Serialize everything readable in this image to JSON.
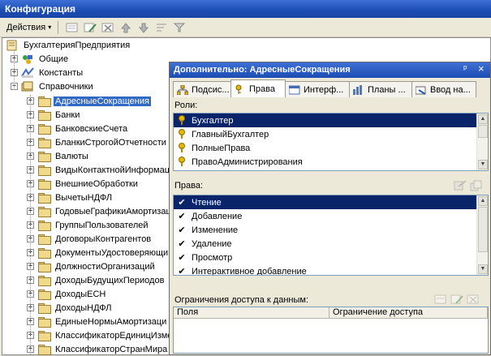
{
  "window": {
    "title": "Конфигурация"
  },
  "toolbar": {
    "actions_label": "Действия",
    "actions_arrow": "▾",
    "buttons": [
      "add-icon",
      "edit-icon",
      "delete-icon",
      "move-up-icon",
      "move-down-icon",
      "sort-icon",
      "filter-icon"
    ]
  },
  "tree": {
    "root": "БухгалтерияПредприятия",
    "top_nodes": [
      "Общие",
      "Константы",
      "Справочники"
    ],
    "items": [
      "АдресныеСокращения",
      "Банки",
      "БанковскиеСчета",
      "БланкиСтрогойОтчетности",
      "Валюты",
      "ВидыКонтактнойИнформаци",
      "ВнешниеОбработки",
      "ВычетыНДФЛ",
      "ГодовыеГрафикиАмортизац",
      "ГруппыПользователей",
      "ДоговорыКонтрагентов",
      "ДокументыУдостоверяющи",
      "ДолжностиОрганизаций",
      "ДоходыБудущихПериодов",
      "ДоходыЕСН",
      "ДоходыНДФЛ",
      "ЕдиныеНормыАмортизаци",
      "КлассификаторЕдиницИзме",
      "КлассификаторСтранМира"
    ],
    "selected_index": 0,
    "expander_plus": "+",
    "expander_minus": "−"
  },
  "panel": {
    "title": "Дополнительно: АдресныеСокращения",
    "pin": "ᵖ",
    "close": "×",
    "tabs": [
      "Подсис...",
      "Права",
      "Интерф...",
      "Планы ...",
      "Ввод на..."
    ],
    "active_tab": 1,
    "roles_label": "Роли:",
    "roles": [
      "Бухгалтер",
      "ГлавныйБухгалтер",
      "ПолныеПрава",
      "ПравоАдминистрирования"
    ],
    "rights_label": "Права:",
    "rights": [
      "Чтение",
      "Добавление",
      "Изменение",
      "Удаление",
      "Просмотр",
      "Интерактивное добавление"
    ],
    "check_mark": "✔",
    "restrictions_label": "Ограничения доступа к данным:",
    "columns": [
      "Поля",
      "Ограничение доступа"
    ],
    "scroll_up": "▲",
    "scroll_down": "▼"
  }
}
